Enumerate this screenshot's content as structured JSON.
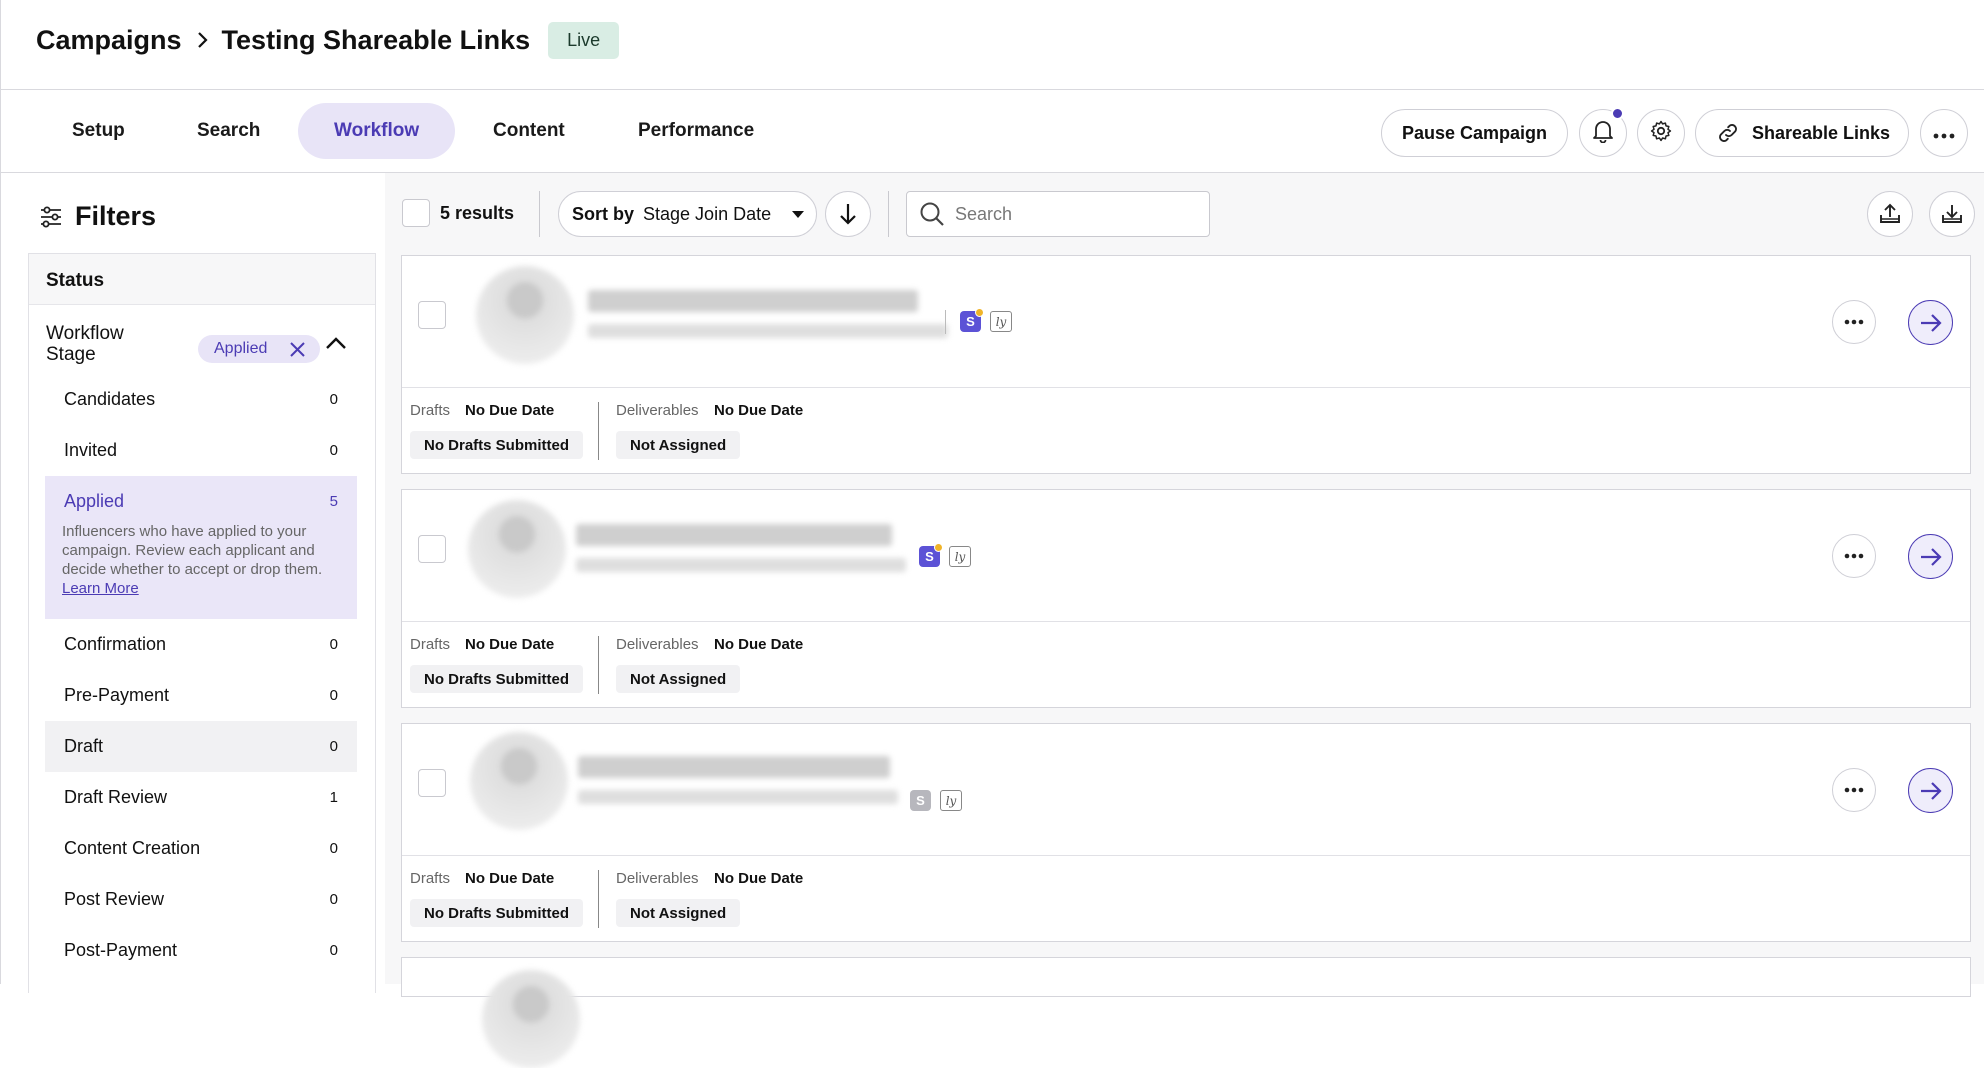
{
  "header": {
    "breadcrumb_root": "Campaigns",
    "breadcrumb_current": "Testing Shareable Links",
    "status_badge": "Live"
  },
  "tabs": [
    {
      "label": "Setup"
    },
    {
      "label": "Search"
    },
    {
      "label": "Workflow",
      "active": true
    },
    {
      "label": "Content"
    },
    {
      "label": "Performance"
    }
  ],
  "actions": {
    "pause": "Pause Campaign",
    "shareable": "Shareable Links"
  },
  "filters": {
    "title": "Filters",
    "status_heading": "Status",
    "stage_label": "Workflow Stage",
    "applied_chip": "Applied",
    "stages": [
      {
        "label": "Candidates",
        "count": "0"
      },
      {
        "label": "Invited",
        "count": "0"
      },
      {
        "label": "Applied",
        "count": "5",
        "active": true,
        "description": "Influencers who have applied to your campaign. Review each applicant and decide whether to accept or drop them.",
        "link": "Learn More"
      },
      {
        "label": "Confirmation",
        "count": "0"
      },
      {
        "label": "Pre-Payment",
        "count": "0"
      },
      {
        "label": "Draft",
        "count": "0",
        "hover": true
      },
      {
        "label": "Draft Review",
        "count": "1"
      },
      {
        "label": "Content Creation",
        "count": "0"
      },
      {
        "label": "Post Review",
        "count": "0"
      },
      {
        "label": "Post-Payment",
        "count": "0"
      }
    ]
  },
  "toolbar": {
    "results": "5 results",
    "sort_label": "Sort by",
    "sort_value": "Stage Join Date",
    "search_placeholder": "Search"
  },
  "cards": [
    {
      "drafts_label": "Drafts",
      "drafts_due": "No Due Date",
      "deliverables_label": "Deliverables",
      "deliverables_due": "No Due Date",
      "drafts_status": "No Drafts Submitted",
      "deliverables_status": "Not Assigned"
    },
    {
      "drafts_label": "Drafts",
      "drafts_due": "No Due Date",
      "deliverables_label": "Deliverables",
      "deliverables_due": "No Due Date",
      "drafts_status": "No Drafts Submitted",
      "deliverables_status": "Not Assigned"
    },
    {
      "drafts_label": "Drafts",
      "drafts_due": "No Due Date",
      "deliverables_label": "Deliverables",
      "deliverables_due": "No Due Date",
      "drafts_status": "No Drafts Submitted",
      "deliverables_status": "Not Assigned"
    }
  ],
  "icons": {
    "s_badge": "S",
    "ly_badge": "ly"
  },
  "colors": {
    "accent": "#4b3bb4",
    "accent_bg": "#e8e4f7",
    "live_bg": "#d9ede4"
  }
}
